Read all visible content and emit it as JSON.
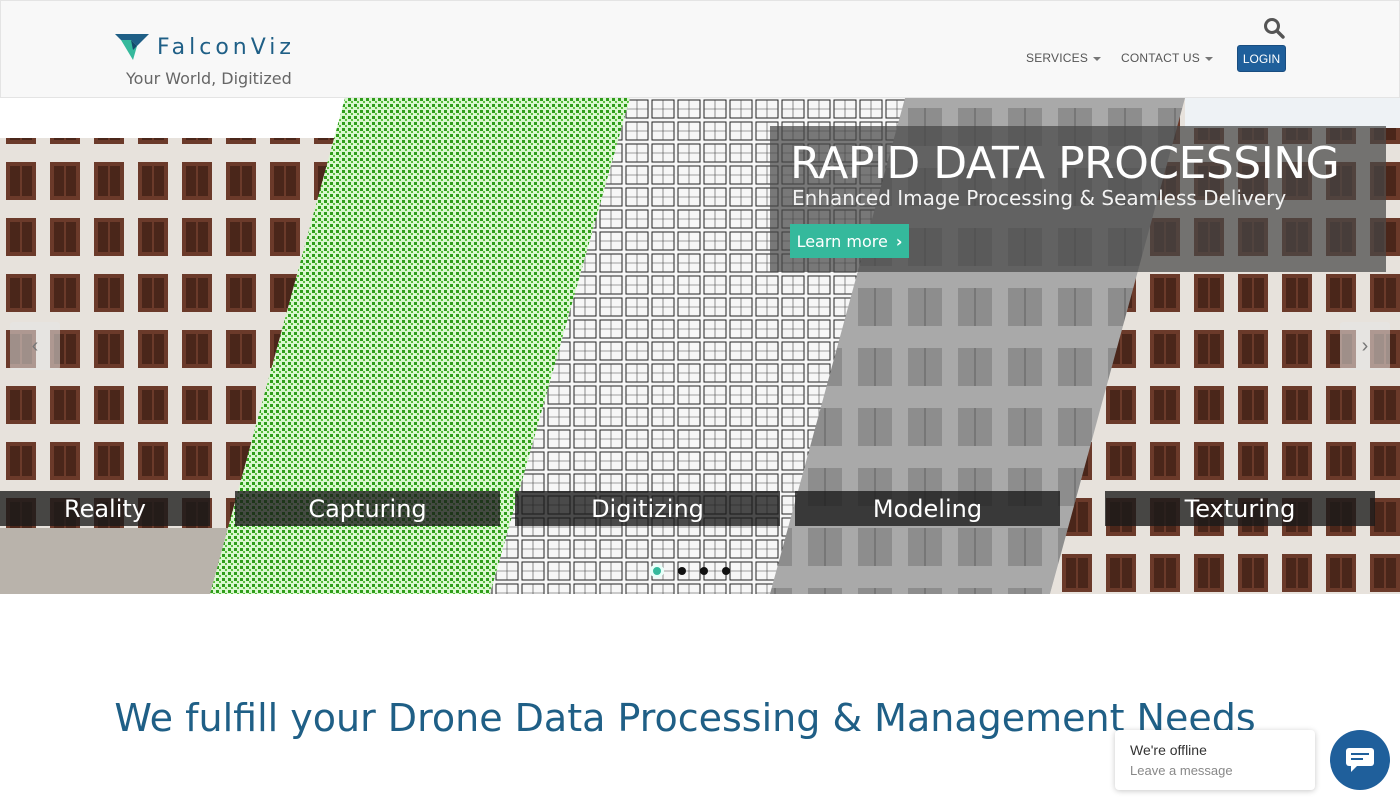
{
  "brand": {
    "name": "FalconViz",
    "tagline": "Your World, Digitized",
    "colors": {
      "primary": "#1f5f86",
      "accent": "#35b99c",
      "login": "#1f5f9b"
    }
  },
  "nav": {
    "services": "SERVICES",
    "contact": "CONTACT US",
    "login": "LOGIN",
    "search_icon": "search-icon"
  },
  "carousel": {
    "title": "RAPID DATA PROCESSING",
    "subtitle": "Enhanced Image Processing & Seamless Delivery",
    "cta": "Learn more",
    "stages": [
      "Reality",
      "Capturing",
      "Digitizing",
      "Modeling",
      "Texturing"
    ],
    "slide_count": 4,
    "active_slide": 1,
    "prev_icon": "chevron-left-icon",
    "next_icon": "chevron-right-icon"
  },
  "main": {
    "headline": "We fulfill your Drone Data Processing & Management Needs"
  },
  "chat": {
    "status": "We're offline",
    "prompt": "Leave a message",
    "icon": "chat-icon"
  }
}
